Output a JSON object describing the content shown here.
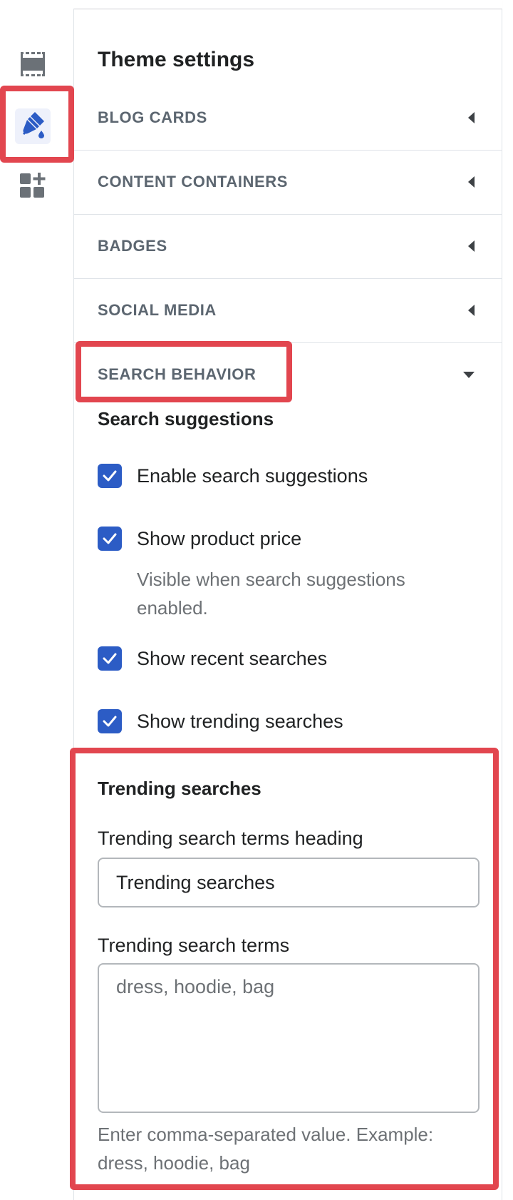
{
  "app": {
    "colors": {
      "accent": "#2c5cc5",
      "highlight": "#e2464f",
      "muted_text": "#6d7175",
      "section_label": "#5c6670"
    }
  },
  "rail": {
    "items": [
      {
        "icon": "sections-icon",
        "active": false
      },
      {
        "icon": "theme-settings-paintbrush-icon",
        "active": true
      },
      {
        "icon": "app-embeds-icon",
        "active": false
      }
    ]
  },
  "panel": {
    "title": "Theme settings",
    "sections": [
      {
        "label": "BLOG CARDS",
        "expanded": false
      },
      {
        "label": "CONTENT CONTAINERS",
        "expanded": false
      },
      {
        "label": "BADGES",
        "expanded": false
      },
      {
        "label": "SOCIAL MEDIA",
        "expanded": false
      },
      {
        "label": "SEARCH BEHAVIOR",
        "expanded": true
      }
    ]
  },
  "search_behavior": {
    "suggestions_heading": "Search suggestions",
    "checkboxes": [
      {
        "label": "Enable search suggestions",
        "checked": true
      },
      {
        "label": "Show product price",
        "checked": true,
        "help": "Visible when search suggestions enabled."
      },
      {
        "label": "Show recent searches",
        "checked": true
      },
      {
        "label": "Show trending searches",
        "checked": true
      }
    ],
    "trending": {
      "heading": "Trending searches",
      "heading_field_label": "Trending search terms heading",
      "heading_field_value": "Trending searches",
      "terms_field_label": "Trending search terms",
      "terms_field_placeholder": "dress, hoodie, bag",
      "terms_help": "Enter comma-separated value. Example: dress, hoodie, bag"
    }
  }
}
